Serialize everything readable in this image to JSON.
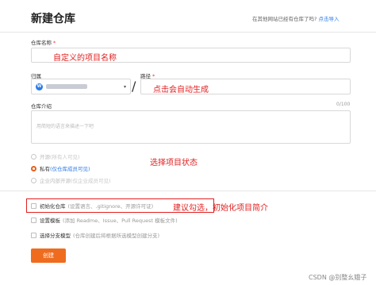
{
  "page": {
    "title": "新建仓库",
    "import_hint": "在其他网站已经有仓库了吗?",
    "import_link": "点击导入"
  },
  "repo_name": {
    "label": "仓库名称",
    "required_mark": "*",
    "annotation": "自定义的项目名称"
  },
  "owner": {
    "label": "归属",
    "avatar_letter": "W",
    "caret": "▾"
  },
  "path": {
    "label": "路径",
    "required_mark": "*",
    "separator": "/",
    "annotation": "点击会自动生成"
  },
  "description": {
    "label": "仓库介绍",
    "counter": "0/100",
    "placeholder": "用简短的语言来描述一下吧"
  },
  "visibility": {
    "annotation": "选择项目状态",
    "options": [
      {
        "label": "开源",
        "sub": "(所有人可见)",
        "checked": false,
        "disabled": true
      },
      {
        "label": "私有",
        "sub": "(仅仓库成员可见)",
        "checked": true,
        "disabled": false
      },
      {
        "label": "企业内部开源",
        "sub": "(仅企业成员可见)",
        "checked": false,
        "disabled": true
      }
    ]
  },
  "init_options": {
    "annotation": "建议勾选，初始化项目简介",
    "items": [
      {
        "label": "初始化仓库",
        "sub": "(设置语言、.gitignore、开源许可证)"
      },
      {
        "label": "设置模板",
        "sub": "(添加 Readme、Issue、Pull Request 模板文件)"
      },
      {
        "label": "选择分支模型",
        "sub": "(仓库创建后将根据所选模型创建分支)"
      }
    ]
  },
  "actions": {
    "create_label": "创建"
  },
  "watermark": "CSDN @别整幺娥子"
}
